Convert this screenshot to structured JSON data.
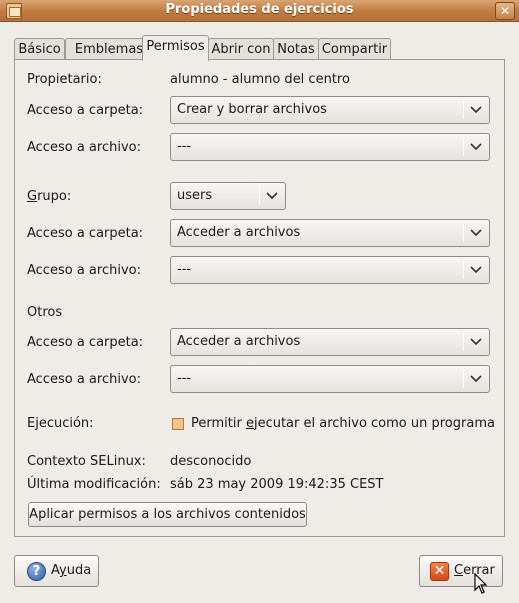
{
  "window": {
    "title": "Propiedades de ejercicios",
    "close_glyph": "✕"
  },
  "tabs": [
    {
      "label": "Básico"
    },
    {
      "label": "Emblemas"
    },
    {
      "label": "Permisos"
    },
    {
      "label": "Abrir con"
    },
    {
      "label": "Notas"
    },
    {
      "label": "Compartir"
    }
  ],
  "active_tab": "Permisos",
  "owner": {
    "label": "Propietario:",
    "value": "alumno - alumno del centro",
    "folder_access_label": "Acceso a carpeta:",
    "folder_access_value": "Crear y borrar archivos",
    "file_access_label": "Acceso a archivo:",
    "file_access_value": "---"
  },
  "group": {
    "label_prefix": "",
    "label_mnemonic": "G",
    "label_rest": "rupo:",
    "value": "users",
    "folder_access_label": "Acceso a carpeta:",
    "folder_access_value": "Acceder a archivos",
    "file_access_label": "Acceso a archivo:",
    "file_access_value": "---"
  },
  "others": {
    "heading": "Otros",
    "folder_access_label": "Acceso a carpeta:",
    "folder_access_value": "Acceder a archivos",
    "file_access_label": "Acceso a archivo:",
    "file_access_value": "---"
  },
  "execution": {
    "label": "Ejecución:",
    "checkbox_prefix": "Permitir ",
    "checkbox_mnemonic": "e",
    "checkbox_rest": "jecutar el archivo como un programa",
    "checked": false
  },
  "selinux": {
    "label": "Contexto SELinux:",
    "value": "desconocido"
  },
  "modified": {
    "label": "Última modificación:",
    "value": "sáb 23 may 2009 19:42:35 CEST"
  },
  "apply_button": {
    "label": "Aplicar permisos a los archivos contenidos"
  },
  "help_button": {
    "icon_glyph": "?",
    "label_prefix": "A",
    "label_mnemonic": "y",
    "label_rest": "uda"
  },
  "close_button": {
    "icon_glyph": "✕",
    "label_prefix": "",
    "label_mnemonic": "C",
    "label_rest": "errar"
  },
  "colors": {
    "titlebar": "#c07a3e",
    "background": "#efebe7",
    "checkbox": "#f8c28a"
  }
}
